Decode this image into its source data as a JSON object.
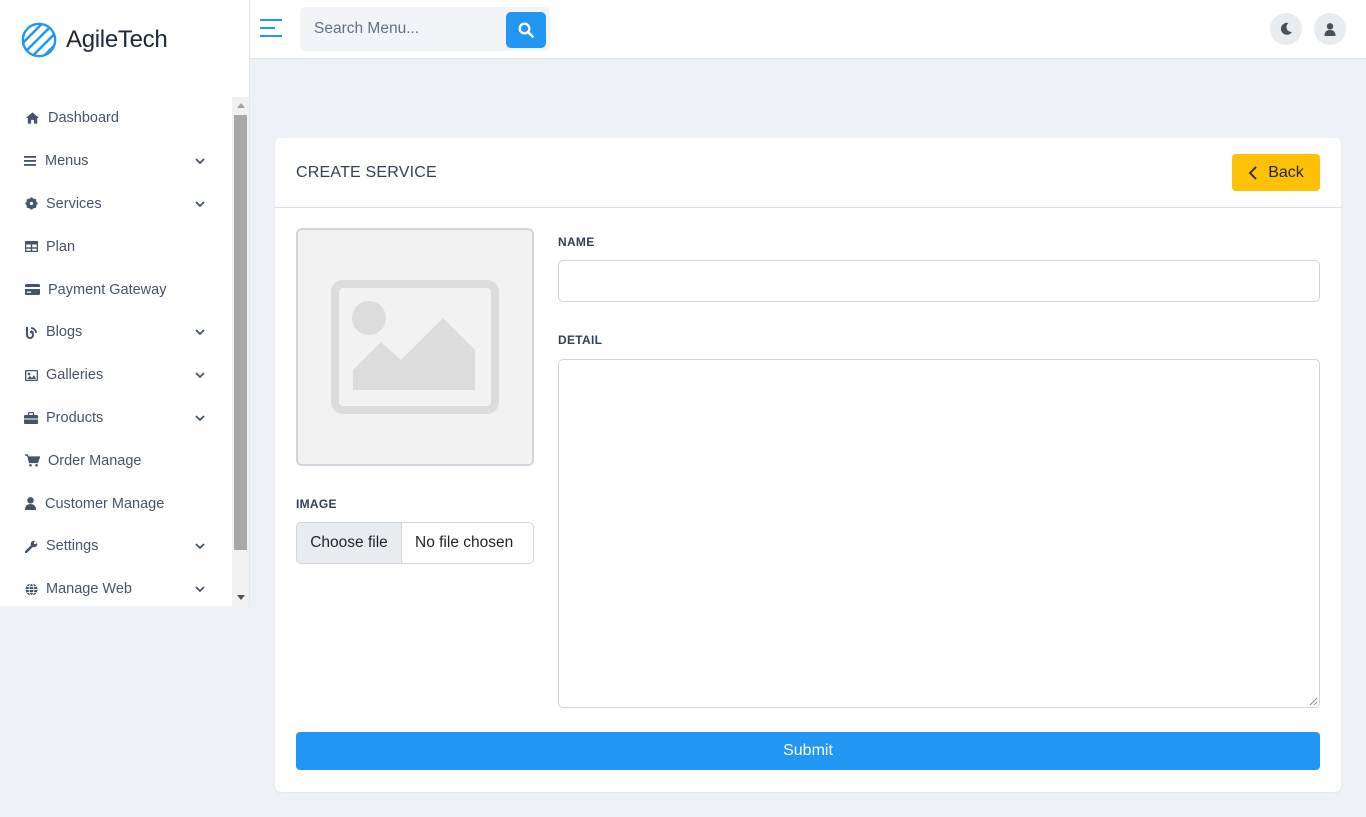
{
  "brand": {
    "name": "AgileTech",
    "accent": "#2196f3"
  },
  "sidebar": {
    "items": [
      {
        "label": "Dashboard",
        "icon": "home-icon",
        "has_submenu": false
      },
      {
        "label": "Menus",
        "icon": "list-icon",
        "has_submenu": true
      },
      {
        "label": "Services",
        "icon": "gear-icon",
        "has_submenu": true
      },
      {
        "label": "Plan",
        "icon": "table-icon",
        "has_submenu": false
      },
      {
        "label": "Payment Gateway",
        "icon": "credit-card-icon",
        "has_submenu": false
      },
      {
        "label": "Blogs",
        "icon": "blog-icon",
        "has_submenu": true
      },
      {
        "label": "Galleries",
        "icon": "image-icon",
        "has_submenu": true
      },
      {
        "label": "Products",
        "icon": "briefcase-icon",
        "has_submenu": true
      },
      {
        "label": "Order Manage",
        "icon": "cart-icon",
        "has_submenu": false
      },
      {
        "label": "Customer Manage",
        "icon": "user-icon",
        "has_submenu": false
      },
      {
        "label": "Settings",
        "icon": "wrench-icon",
        "has_submenu": true
      },
      {
        "label": "Manage Web",
        "icon": "globe-icon",
        "has_submenu": true
      }
    ]
  },
  "topbar": {
    "search": {
      "placeholder": "Search Menu...",
      "value": ""
    }
  },
  "form": {
    "title": "CREATE SERVICE",
    "back_label": "Back",
    "image_label": "IMAGE",
    "file_button_label": "Choose file",
    "file_status": "No file chosen",
    "name_label": "NAME",
    "name_value": "",
    "detail_label": "DETAIL",
    "detail_value": "",
    "submit_label": "Submit"
  },
  "colors": {
    "primary": "#2196f3",
    "warning": "#ffc107",
    "background": "#eef2f7"
  }
}
